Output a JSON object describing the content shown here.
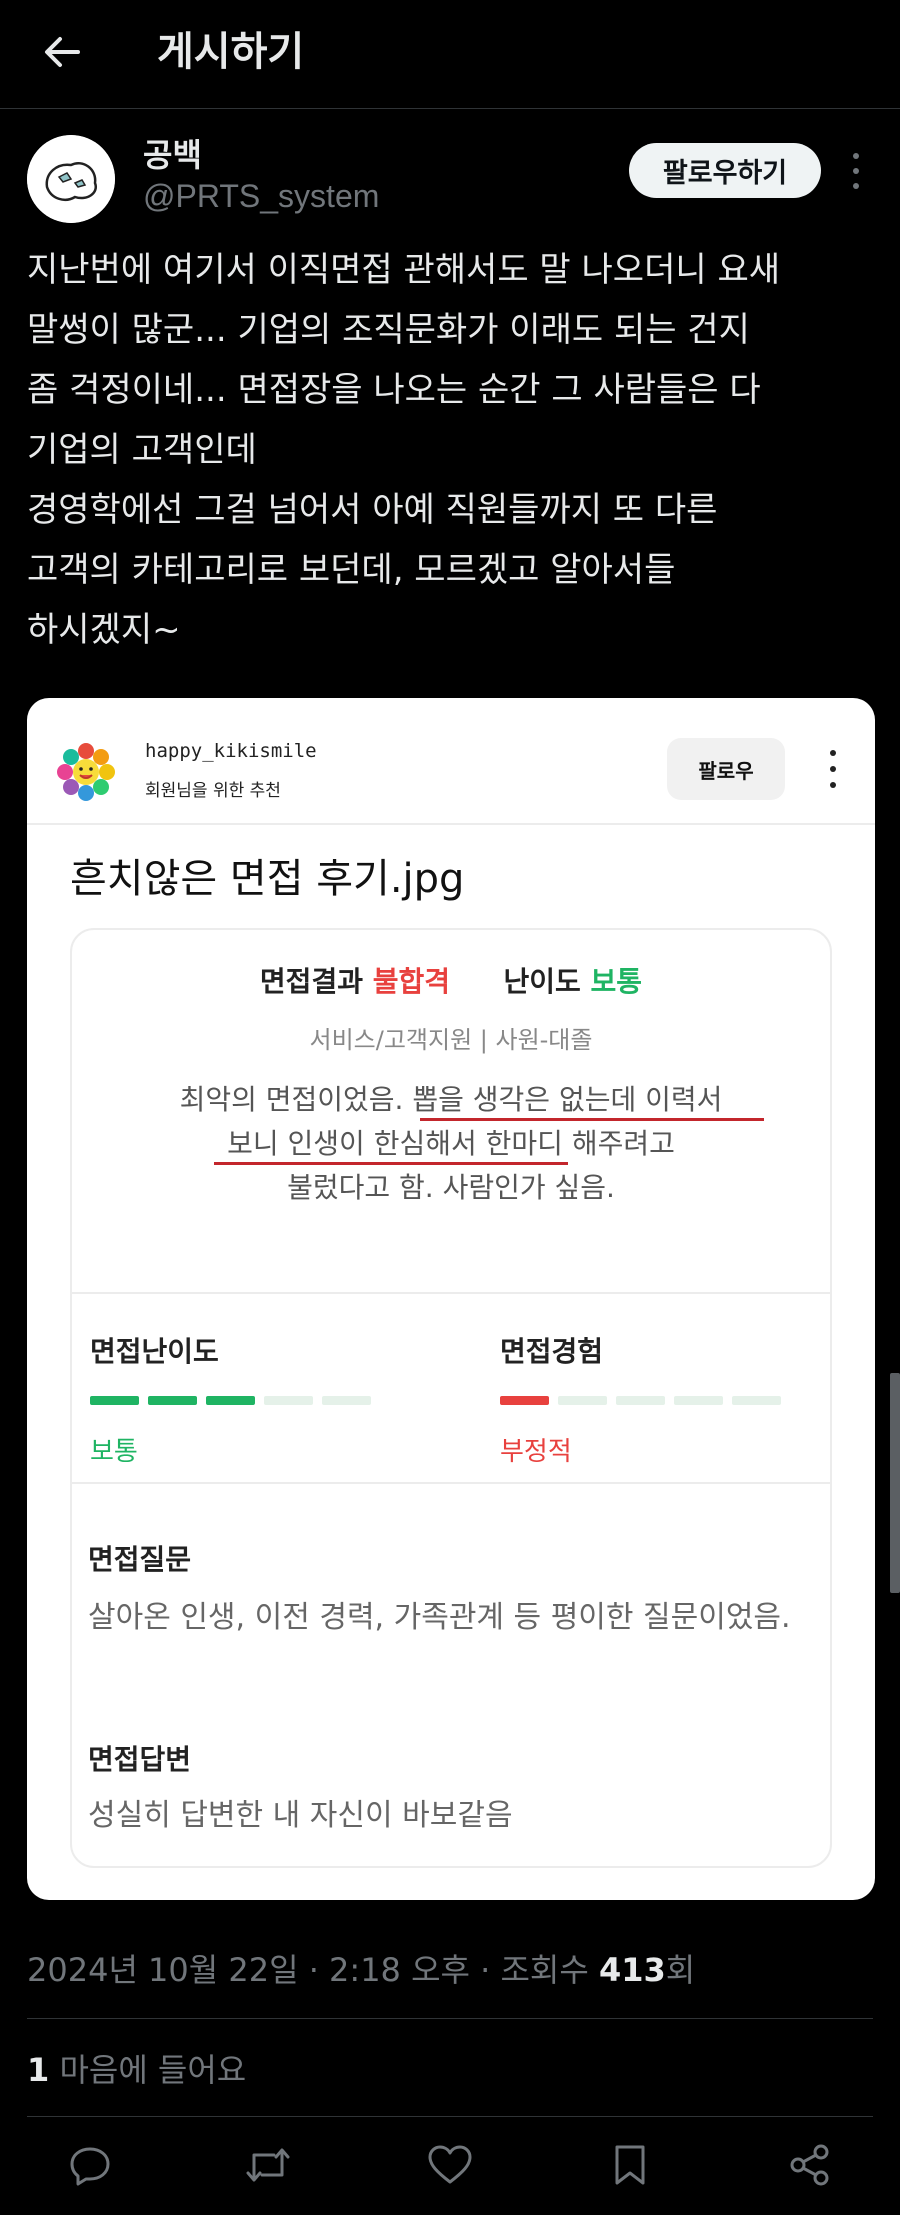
{
  "header": {
    "title": "게시하기"
  },
  "author": {
    "name": "공백",
    "handle": "@PRTS_system",
    "follow_label": "팔로우하기"
  },
  "tweet": {
    "lines": [
      "지난번에 여기서 이직면접 관해서도 말 나오더니 요새",
      "말썽이 많군... 기업의 조직문화가 이래도 되는 건지",
      "좀 걱정이네... 면접장을 나오는 순간 그 사람들은 다",
      "기업의 고객인데",
      "경영학에선 그걸 넘어서 아예 직원들까지 또 다른",
      "고객의 카테고리로 보던데, 모르겠고 알아서들",
      "하시겠지~"
    ]
  },
  "embed": {
    "username": "happy_kikismile",
    "subtitle": "회원님을 위한 추천",
    "follow_label": "팔로우",
    "post_title": "흔치않은 면접 후기.jpg",
    "review": {
      "result_label": "면접결과",
      "result_value": "불합격",
      "difficulty_label": "난이도",
      "difficulty_value": "보통",
      "category": "서비스/고객지원 | 사원-대졸",
      "comment_lines": [
        "최악의 면접이었음. 뽑을 생각은 없는데 이력서",
        "보니 인생이 한심해서 한마디 해주려고",
        "불렀다고 함. 사람인가 싶음."
      ],
      "metric_difficulty": {
        "title": "면접난이도",
        "value": "보통",
        "level": 3,
        "max": 5,
        "color": "#1fb463"
      },
      "metric_experience": {
        "title": "면접경험",
        "value": "부정적",
        "level": 1,
        "max": 5,
        "color": "#e8413e"
      },
      "questions_title": "면접질문",
      "questions_body": "살아온 인생, 이전 경력, 가족관계 등 평이한 질문이었음.",
      "answers_title": "면접답변",
      "answers_body": "성실히 답변한 내 자신이 바보같음"
    }
  },
  "meta": {
    "datetime": "2024년 10월 22일 · 2:18 오후 · 조회수 ",
    "views": "413",
    "views_suffix": "회"
  },
  "likes": {
    "count": "1",
    "label": " 마음에 들어요"
  },
  "actions": [
    "reply-icon",
    "retweet-icon",
    "like-icon",
    "bookmark-icon",
    "share-icon"
  ]
}
